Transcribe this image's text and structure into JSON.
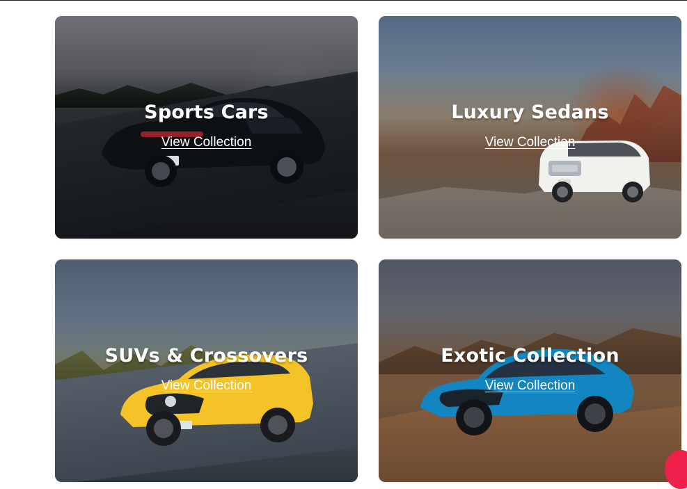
{
  "cards": [
    {
      "title": "Sports Cars",
      "link_label": "View Collection"
    },
    {
      "title": "Luxury Sedans",
      "link_label": "View Collection"
    },
    {
      "title": "SUVs & Crossovers",
      "link_label": "View Collection"
    },
    {
      "title": "Exotic Collection",
      "link_label": "View Collection"
    }
  ],
  "icons": {
    "corner_badge": "circle-badge"
  },
  "colors": {
    "page_background": "#ffffff",
    "text_primary": "#ffffff",
    "accent_badge": "#ef1f4b"
  }
}
